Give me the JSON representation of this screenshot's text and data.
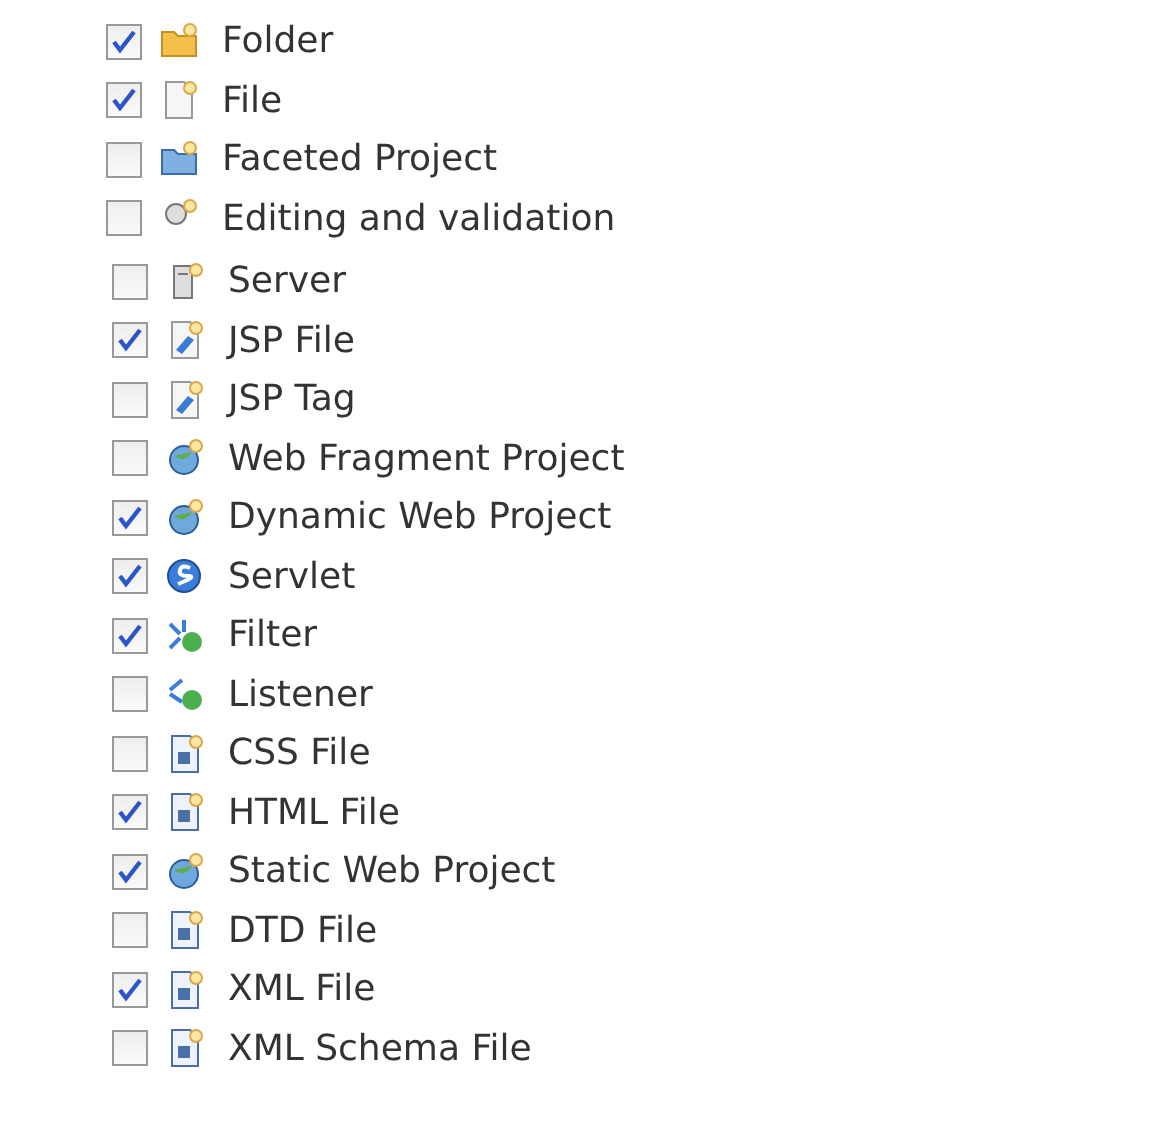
{
  "groups": [
    {
      "items": [
        {
          "label": "Folder",
          "checked": true
        },
        {
          "label": "File",
          "checked": true
        },
        {
          "label": "Faceted Project",
          "checked": false
        },
        {
          "label": "Editing and validation",
          "checked": false
        }
      ]
    },
    {
      "items": [
        {
          "label": "Server",
          "checked": false
        },
        {
          "label": "JSP File",
          "checked": true
        },
        {
          "label": "JSP Tag",
          "checked": false
        },
        {
          "label": "Web Fragment Project",
          "checked": false
        },
        {
          "label": "Dynamic Web Project",
          "checked": true
        },
        {
          "label": "Servlet",
          "checked": true
        },
        {
          "label": "Filter",
          "checked": true
        },
        {
          "label": "Listener",
          "checked": false
        },
        {
          "label": "CSS File",
          "checked": false
        },
        {
          "label": "HTML File",
          "checked": true
        },
        {
          "label": "Static Web Project",
          "checked": true
        },
        {
          "label": "DTD File",
          "checked": false
        },
        {
          "label": "XML File",
          "checked": true
        },
        {
          "label": "XML Schema File",
          "checked": false
        }
      ]
    }
  ]
}
